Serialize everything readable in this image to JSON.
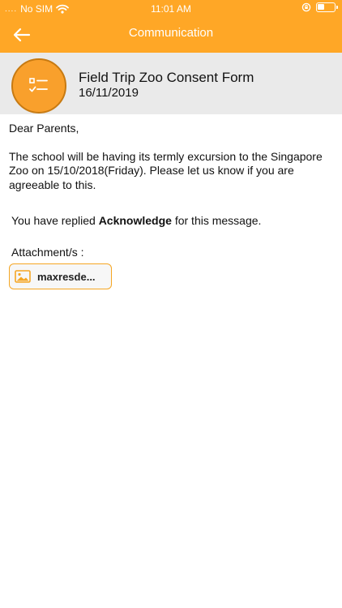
{
  "status_bar": {
    "signal": "....",
    "carrier": "No SIM",
    "time": "11:01 AM"
  },
  "nav": {
    "title": "Communication",
    "back_icon": "arrow-left-icon"
  },
  "message": {
    "icon": "checklist-icon",
    "title": "Field Trip Zoo Consent Form",
    "date": "16/11/2019",
    "greeting": "Dear Parents,",
    "body": "The school will be having its termly excursion to the Singapore Zoo on 15/10/2018(Friday). Please let us know if you are agreeable to this."
  },
  "reply": {
    "prefix": "You have replied",
    "response": "Acknowledge",
    "suffix": "for this message."
  },
  "attachments": {
    "label": "Attachment/s :",
    "items": [
      {
        "name": "maxresde...",
        "icon": "image-icon"
      }
    ]
  },
  "colors": {
    "accent": "#FFA726",
    "header_bg": "#EAEAEA",
    "avatar_bg": "#F9A02C"
  }
}
